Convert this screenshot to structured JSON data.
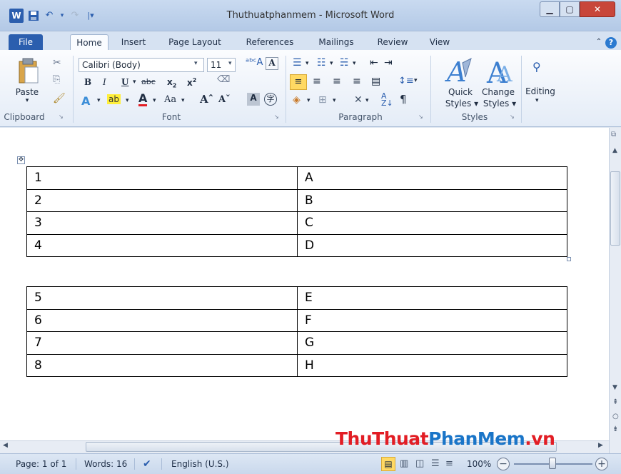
{
  "app": {
    "title": "Thuthuatphanmem - Microsoft Word",
    "icon": "W"
  },
  "tabs": [
    "File",
    "Home",
    "Insert",
    "Page Layout",
    "References",
    "Mailings",
    "Review",
    "View"
  ],
  "ribbon": {
    "clipboard": {
      "paste": "Paste",
      "label": "Clipboard"
    },
    "font": {
      "name": "Calibri (Body)",
      "size": "11",
      "label": "Font"
    },
    "paragraph": {
      "label": "Paragraph"
    },
    "styles": {
      "quick": "Quick",
      "quick2": "Styles",
      "change": "Change",
      "change2": "Styles",
      "label": "Styles"
    },
    "editing": {
      "label": "Editing"
    }
  },
  "tables": [
    {
      "rows": [
        [
          "1",
          "A"
        ],
        [
          "2",
          "B"
        ],
        [
          "3",
          "C"
        ],
        [
          "4",
          "D"
        ]
      ]
    },
    {
      "rows": [
        [
          "5",
          "E"
        ],
        [
          "6",
          "F"
        ],
        [
          "7",
          "G"
        ],
        [
          "8",
          "H"
        ]
      ]
    }
  ],
  "status": {
    "page": "Page: 1 of 1",
    "words": "Words: 16",
    "lang": "English (U.S.)",
    "zoom": "100%"
  },
  "watermark": {
    "part1": "ThuThuat",
    "part2": "PhanMem",
    "part3": ".vn"
  },
  "colors": {
    "accent": "#2b5eae",
    "wm_red": "#e21d24",
    "wm_blue": "#1a75c8"
  }
}
